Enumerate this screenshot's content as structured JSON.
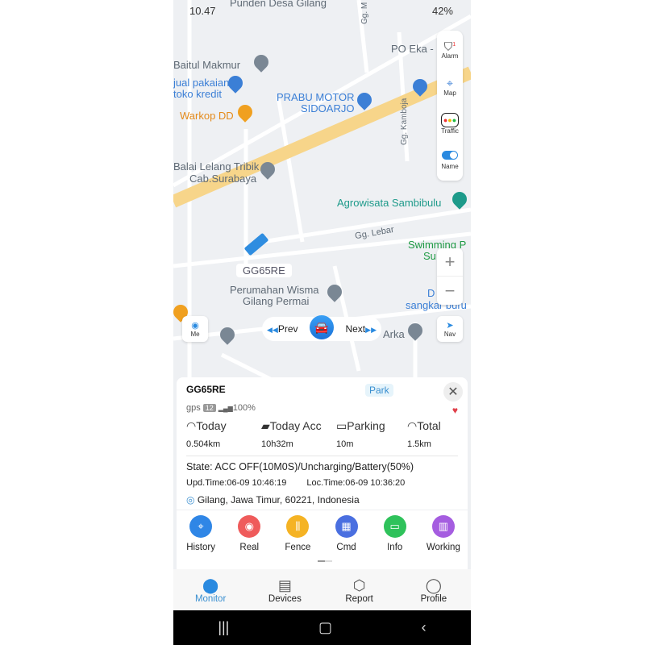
{
  "status_bar": {
    "time": "10.47",
    "battery": "42%"
  },
  "map": {
    "labels": [
      "Punden Desa Gilang",
      "Baitul Makmur",
      "jual pakaian",
      "toko kredit",
      "PO Eka -",
      "PRABU MOTOR",
      "SIDOARJO",
      "Warkop DD",
      "Gg. Kamboja",
      "Balai Lelang Tribik",
      "Cab.Surabaya",
      "Agrowisata Sambibulu",
      "Gg. Lebar",
      "Swimming P",
      "Su",
      "Perumahan Wisma",
      "Gilang Permai",
      "D",
      "sangkar buru",
      "Arka",
      "Gg. M"
    ],
    "vehicle_label": "GG65RE"
  },
  "side_controls": [
    {
      "label": "Alarm",
      "icon": "shield-alert-icon",
      "badge": "1"
    },
    {
      "label": "Map",
      "icon": "map-icon"
    },
    {
      "label": "Traffic",
      "icon": "traffic-icon"
    },
    {
      "label": "Name",
      "icon": "toggle-icon",
      "toggle_on": true
    }
  ],
  "zoom": {
    "in": "+",
    "out": "−"
  },
  "me_label": "Me",
  "nav_label": "Nav",
  "pager": {
    "prev": "Prev",
    "next": "Next"
  },
  "device": {
    "name": "GG65RE",
    "status": "Park",
    "gps_label": "gps",
    "satellites": "12",
    "signal": "100%",
    "stats": [
      {
        "label": "Today",
        "value": "0.504km"
      },
      {
        "label": "Today Acc",
        "value": "10h32m"
      },
      {
        "label": "Parking",
        "value": "10m"
      },
      {
        "label": "Total",
        "value": "1.5km"
      }
    ],
    "state": "State: ACC OFF(10M0S)/Uncharging/Battery(50%)",
    "upd_time": "Upd.Time:06-09 10:46:19",
    "loc_time": "Loc.Time:06-09 10:36:20",
    "address": "Gilang, Jawa Timur, 60221, Indonesia"
  },
  "actions": [
    {
      "label": "History",
      "color": "#2f86e6"
    },
    {
      "label": "Real",
      "color": "#ef5b5b"
    },
    {
      "label": "Fence",
      "color": "#f5b324"
    },
    {
      "label": "Cmd",
      "color": "#4a6fe0"
    },
    {
      "label": "Info",
      "color": "#2fc25b"
    },
    {
      "label": "Working",
      "color": "#a55de0"
    }
  ],
  "tabs": [
    {
      "label": "Monitor",
      "active": true
    },
    {
      "label": "Devices"
    },
    {
      "label": "Report"
    },
    {
      "label": "Profile"
    }
  ],
  "accent": "#2a8ae0"
}
